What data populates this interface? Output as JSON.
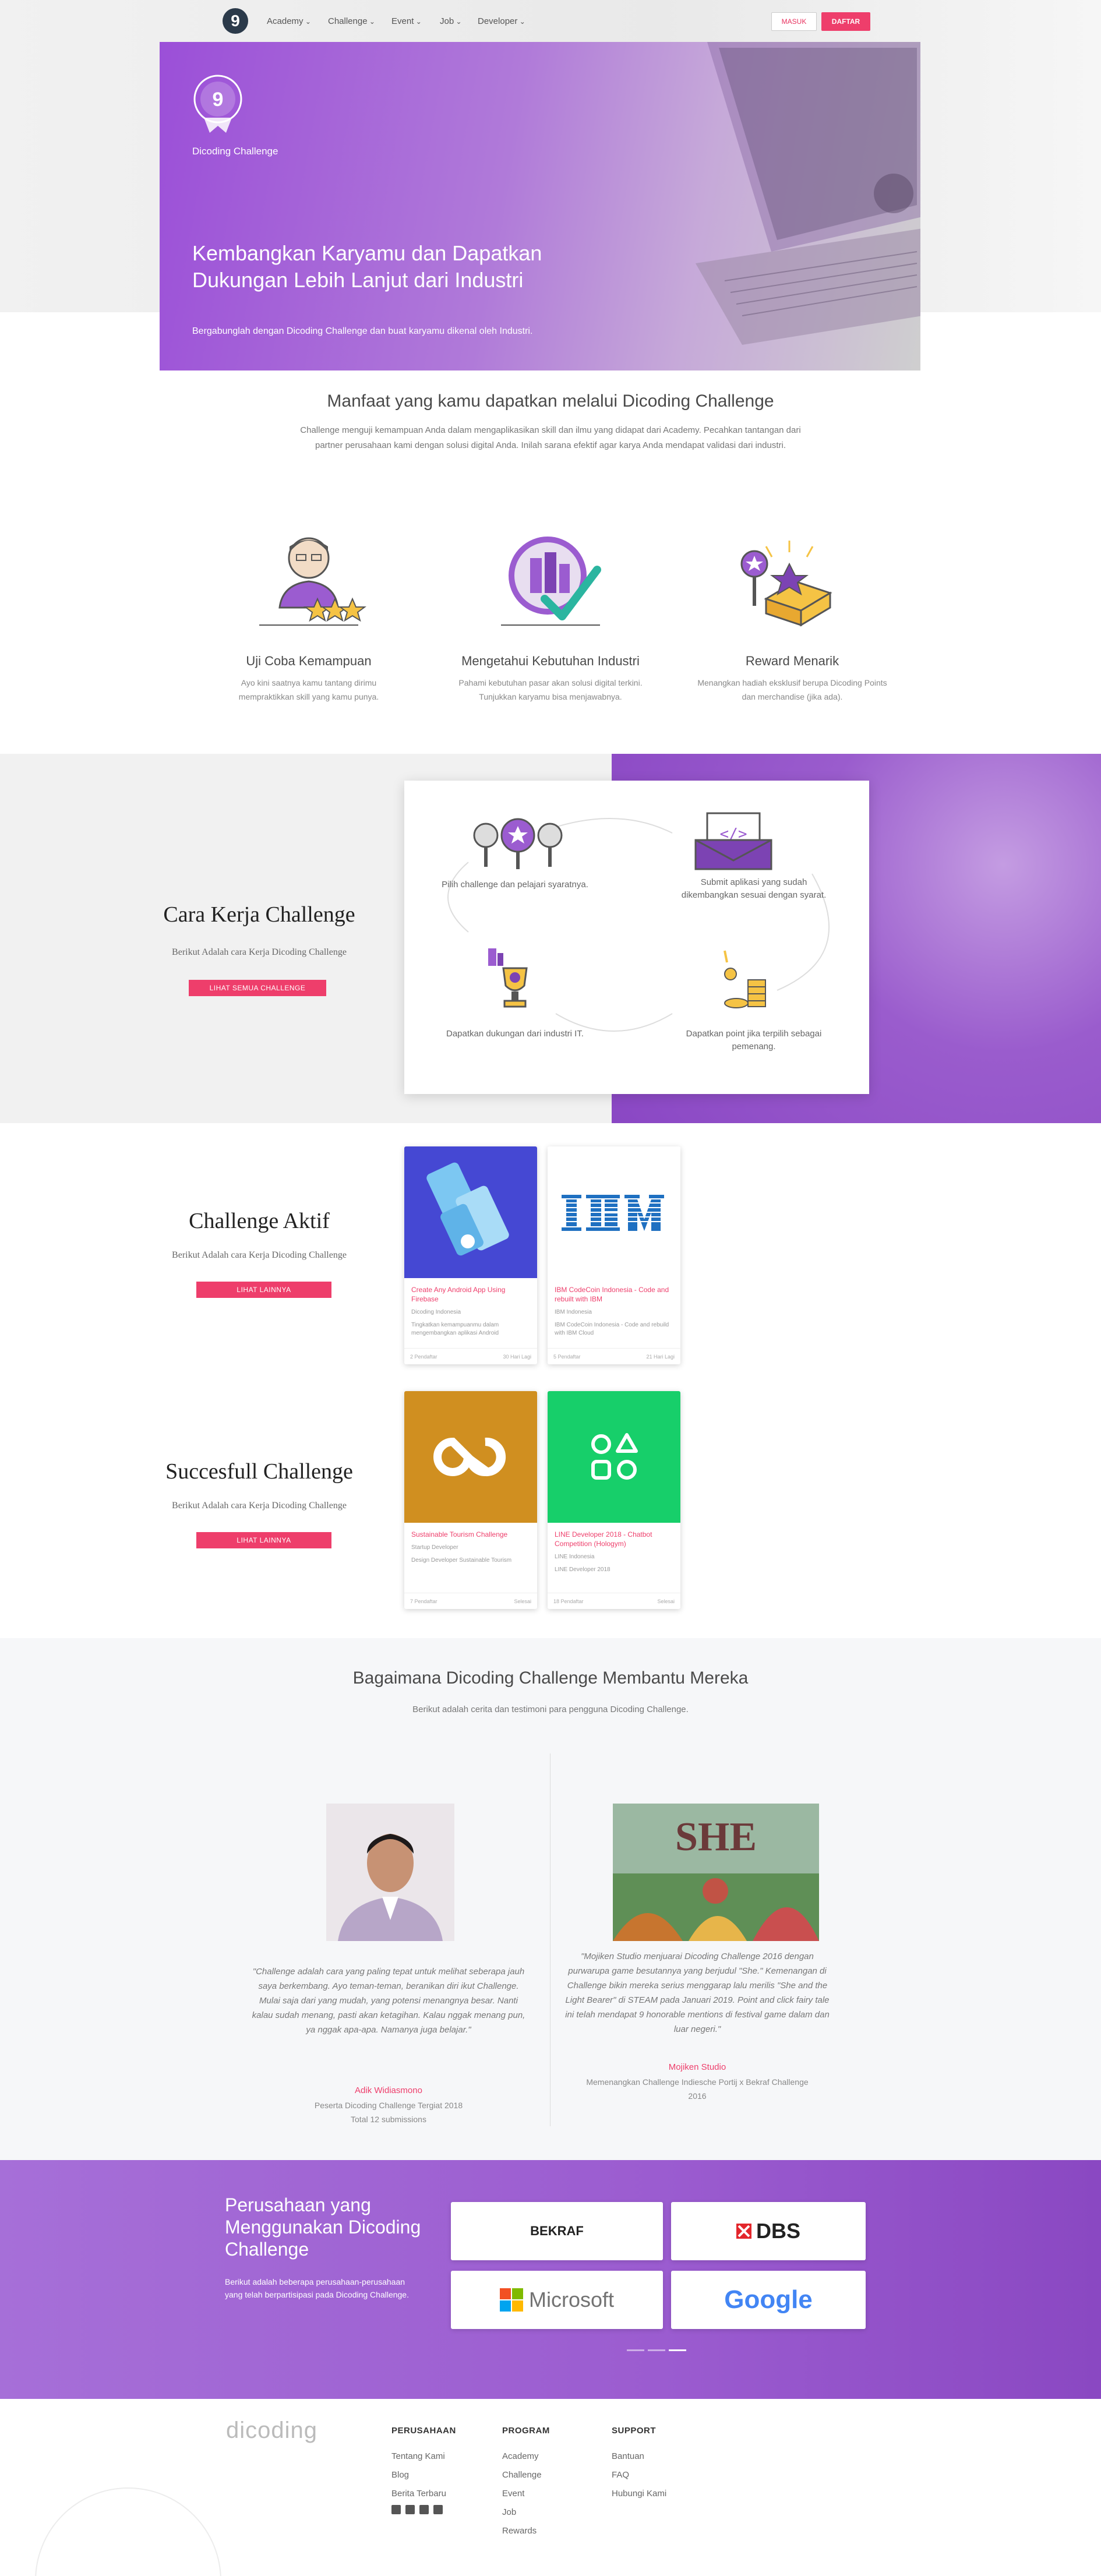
{
  "nav": {
    "logo": "9",
    "items": [
      "Academy",
      "Challenge",
      "Event",
      "Job",
      "Developer"
    ],
    "login": "MASUK",
    "register": "DAFTAR"
  },
  "hero": {
    "badge_text": "9",
    "brand": "Dicoding Challenge",
    "title": "Kembangkan Karyamu dan Dapatkan Dukungan Lebih Lanjut dari Industri",
    "subtitle": "Bergabunglah dengan Dicoding Challenge dan buat karyamu dikenal oleh Industri."
  },
  "manfaat": {
    "title": "Manfaat yang kamu dapatkan melalui Dicoding Challenge",
    "description": "Challenge menguji kemampuan Anda dalam mengaplikasikan skill dan ilmu yang didapat dari Academy. Pecahkan tantangan dari partner perusahaan kami dengan solusi digital Anda. Inilah sarana efektif agar karya Anda mendapat validasi dari industri.",
    "items": [
      {
        "title": "Uji Coba Kemampuan",
        "desc": "Ayo kini saatnya kamu tantang dirimu mempraktikkan skill yang kamu punya."
      },
      {
        "title": "Mengetahui Kebutuhan Industri",
        "desc": "Pahami kebutuhan pasar akan solusi digital terkini. Tunjukkan karyamu bisa menjawabnya."
      },
      {
        "title": "Reward Menarik",
        "desc": "Menangkan hadiah eksklusif berupa Dicoding Points dan merchandise (jika ada)."
      }
    ]
  },
  "cara_kerja": {
    "title": "Cara Kerja Challenge",
    "subtitle": "Berikut Adalah cara Kerja Dicoding Challenge",
    "button": "LIHAT SEMUA CHALLENGE",
    "steps": [
      "Pilih challenge dan pelajari syaratnya.",
      "Submit aplikasi yang sudah dikembangkan sesuai dengan syarat.",
      "Dapatkan dukungan dari industri IT.",
      "Dapatkan point jika terpilih sebagai pemenang."
    ]
  },
  "aktif": {
    "title": "Challenge Aktif",
    "subtitle": "Berikut Adalah cara Kerja Dicoding Challenge",
    "button": "LIHAT LAINNYA",
    "cards": [
      {
        "title": "Create Any Android App Using Firebase",
        "sub1": "Dicoding Indonesia",
        "sub2": "Tingkatkan kemampuanmu dalam mengembangkan aplikasi Android",
        "left": "2 Pendaftar",
        "right": "30 Hari Lagi"
      },
      {
        "title": "IBM CodeCoin Indonesia - Code and rebuilt with IBM",
        "sub1": "IBM Indonesia",
        "sub2": "IBM CodeCoin Indonesia - Code and rebuild with IBM Cloud",
        "left": "5 Pendaftar",
        "right": "21 Hari Lagi"
      }
    ]
  },
  "sukses": {
    "title": "Succesfull Challenge",
    "subtitle": "Berikut Adalah cara Kerja Dicoding Challenge",
    "button": "LIHAT LAINNYA",
    "cards": [
      {
        "title": "Sustainable Tourism Challenge",
        "sub1": "Startup Developer",
        "sub2": "Design Developer Sustainable Tourism",
        "left": "7 Pendaftar",
        "right": "Selesai"
      },
      {
        "title": "LINE Developer 2018 - Chatbot Competition (Hologym)",
        "sub1": "LINE Indonesia",
        "sub2": "LINE Developer 2018",
        "left": "18 Pendaftar",
        "right": "Selesai"
      }
    ]
  },
  "testimoni": {
    "title": "Bagaimana Dicoding Challenge Membantu Mereka",
    "subtitle": "Berikut adalah cerita dan testimoni para pengguna Dicoding Challenge.",
    "items": [
      {
        "quote": "\"Challenge adalah cara yang paling tepat untuk melihat seberapa jauh saya berkembang. Ayo teman-teman, beranikan diri ikut Challenge. Mulai saja dari yang mudah, yang potensi menangnya besar. Nanti kalau sudah menang, pasti akan ketagihan. Kalau nggak menang pun, ya nggak apa-apa. Namanya juga belajar.\"",
        "name": "Adik Widiasmono",
        "role1": "Peserta Dicoding Challenge Tergiat 2018",
        "role2": "Total 12 submissions"
      },
      {
        "quote": "\"Mojiken Studio menjuarai Dicoding Challenge 2016 dengan purwarupa game besutannya yang berjudul \"She.\" Kemenangan di Challenge bikin mereka serius menggarap lalu merilis \"She and the Light Bearer\" di STEAM pada Januari 2019. Point and click fairy tale ini telah mendapat 9 honorable mentions di festival game dalam dan luar negeri.\"",
        "name": "Mojiken Studio",
        "role1": "Memenangkan Challenge Indiesche Portij x Bekraf Challenge",
        "role2": "2016"
      }
    ]
  },
  "perusahaan": {
    "title": "Perusahaan yang Menggunakan Dicoding Challenge",
    "desc": "Berikut adalah beberapa perusahaan-perusahaan yang telah berpartisipasi pada Dicoding Challenge.",
    "logos": [
      "BEKRAF",
      "DBS",
      "Microsoft",
      "Google"
    ]
  },
  "footer": {
    "brand": "dicoding",
    "cols": [
      {
        "head": "PERUSAHAAN",
        "links": [
          "Tentang Kami",
          "Blog",
          "Berita Terbaru"
        ]
      },
      {
        "head": "PROGRAM",
        "links": [
          "Academy",
          "Challenge",
          "Event",
          "Job",
          "Rewards"
        ]
      },
      {
        "head": "SUPPORT",
        "links": [
          "Bantuan",
          "FAQ",
          "Hubungi Kami"
        ]
      }
    ]
  },
  "colors": {
    "accent": "#ee3e6b",
    "purple": "#9b5cd0"
  }
}
